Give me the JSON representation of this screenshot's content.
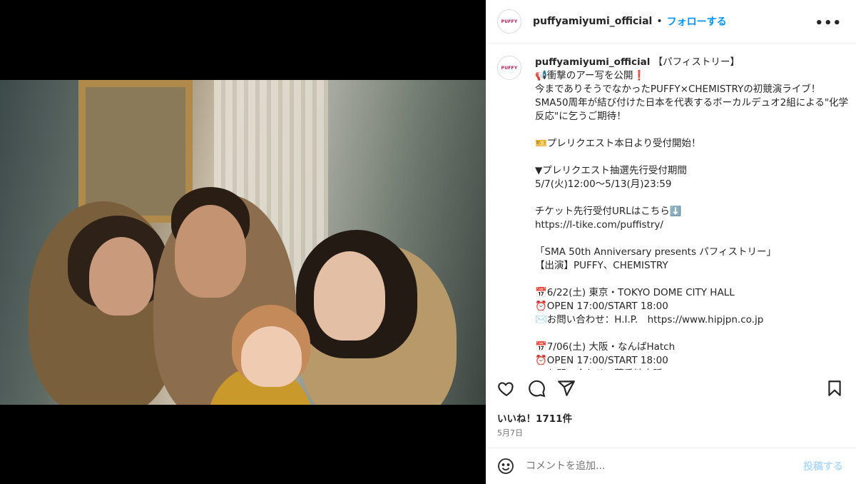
{
  "header": {
    "avatar_text": "PUFFY",
    "username": "puffyamiyumi_official",
    "separator": "•",
    "follow_label": "フォローする",
    "more_icon": "more-horizontal-icon"
  },
  "caption": {
    "username": "puffyamiyumi_official",
    "text": "【パフィストリー】\n📢衝撃のアー写を公開❗\n今までありそうでなかったPUFFY×CHEMISTRYの初競演ライブ！\nSMA50周年が結び付けた日本を代表するボーカルデュオ2組による\"化学反応\"に乞うご期待！\n\n🎫プレリクエスト本日より受付開始！\n\n▼プレリクエスト抽選先行受付期間\n5/7(火)12:00〜5/13(月)23:59\n\nチケット先行受付URLはこちら⬇️\nhttps://l-tike.com/puffistry/\n\n「SMA 50th Anniversary presents パフィストリー」\n【出演】PUFFY、CHEMISTRY\n\n📅6/22(土) 東京・TOKYO DOME CITY HALL\n⏰OPEN 17:00/START 18:00\n✉️お問い合わせ：H.I.P.　https://www.hipjpn.co.jp\n\n📅7/06(土) 大阪・なんばHatch\n⏰OPEN 17:00/START 18:00\n✉️お問い合わせ：夢番地大阪 http://www.yumebanchi.jp"
  },
  "actions": {
    "like_icon": "heart-icon",
    "comment_icon": "comment-icon",
    "share_icon": "send-icon",
    "save_icon": "bookmark-icon"
  },
  "likes_text": "いいね！1711件",
  "date_text": "5月7日",
  "comment": {
    "emoji_icon": "smiley-icon",
    "placeholder": "コメントを追加...",
    "post_label": "投稿する"
  },
  "colors": {
    "accent": "#0095f6",
    "post_disabled": "#b3dbff"
  }
}
